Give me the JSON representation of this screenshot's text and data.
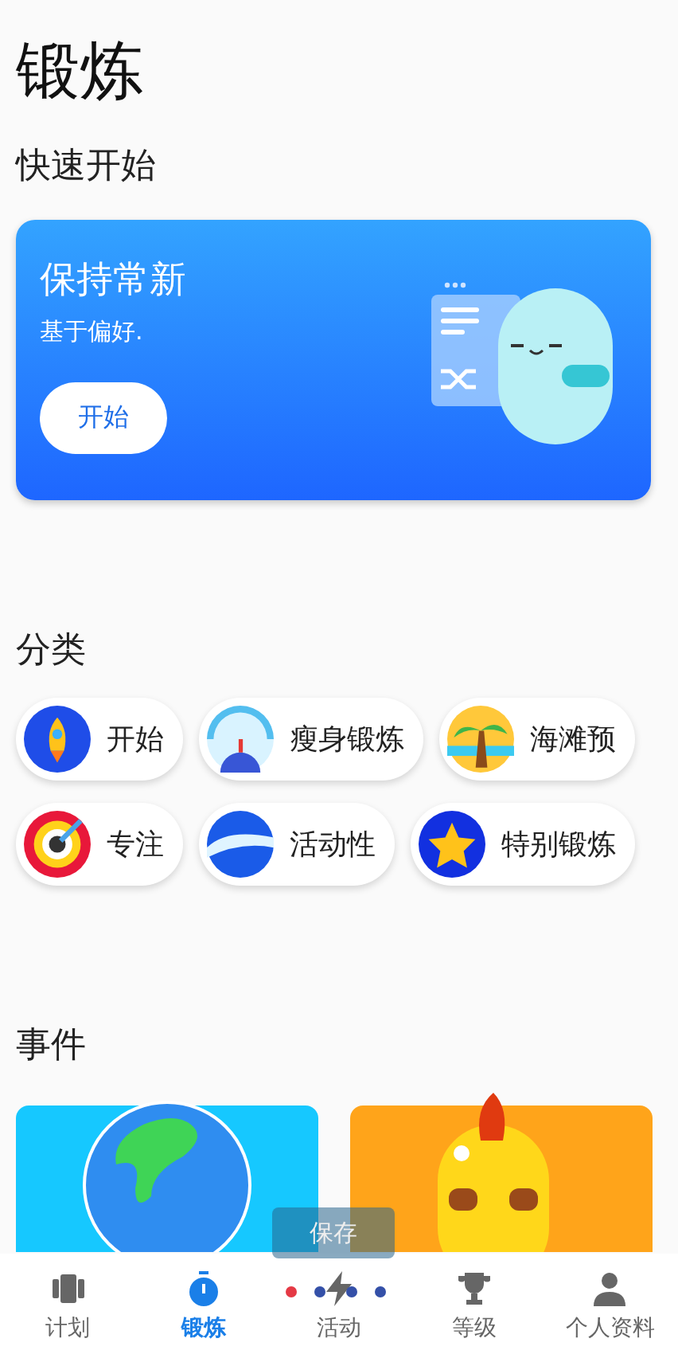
{
  "page_title": "锻炼",
  "quick_start": {
    "heading": "快速开始",
    "card": {
      "title": "保持常新",
      "subtitle": "基于偏好.",
      "button": "开始"
    }
  },
  "categories": {
    "heading": "分类",
    "rows": [
      [
        {
          "label": "开始",
          "kind": "rocket"
        },
        {
          "label": "瘦身锻炼",
          "kind": "gauge"
        },
        {
          "label": "海滩预",
          "kind": "palm"
        }
      ],
      [
        {
          "label": "专注",
          "kind": "target"
        },
        {
          "label": "活动性",
          "kind": "wave"
        },
        {
          "label": "特别锻炼",
          "kind": "star"
        }
      ]
    ]
  },
  "events": {
    "heading": "事件",
    "cards": [
      {
        "kind": "globe"
      },
      {
        "kind": "helmet"
      }
    ]
  },
  "toast": "保存",
  "nav": [
    {
      "label": "计划",
      "kind": "plan",
      "selected": false
    },
    {
      "label": "锻炼",
      "kind": "timer",
      "selected": true
    },
    {
      "label": "活动",
      "kind": "bolt",
      "selected": false
    },
    {
      "label": "等级",
      "kind": "trophy",
      "selected": false
    },
    {
      "label": "个人资料",
      "kind": "person",
      "selected": false
    }
  ]
}
